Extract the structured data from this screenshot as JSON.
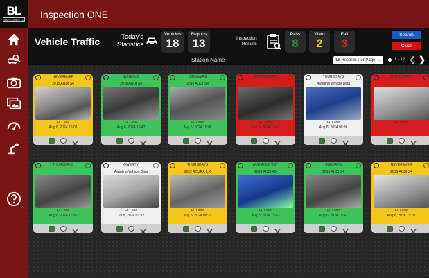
{
  "app": {
    "brand": "BL",
    "brand_sub": "BARCODE/ETC",
    "title": "Inspection ONE"
  },
  "sidebar": {
    "items": [
      {
        "icon": "home-icon"
      },
      {
        "icon": "search-car-icon"
      },
      {
        "icon": "camera-icon"
      },
      {
        "icon": "gallery-icon"
      },
      {
        "icon": "speedometer-icon"
      },
      {
        "icon": "robot-arm-icon"
      },
      {
        "icon": "help-icon"
      }
    ]
  },
  "stats": {
    "page_title": "Vehicle Traffic",
    "today_label_1": "Today's",
    "today_label_2": "Statistics",
    "vehicles_label": "Vehicles",
    "vehicles_value": "18",
    "reports_label": "Reports",
    "reports_value": "13",
    "inspection_label_1": "Inspection",
    "inspection_label_2": "Results",
    "pass_label": "Pass",
    "pass_value": "8",
    "warn_label": "Warn",
    "warn_value": "2",
    "fail_label": "Fail",
    "fail_value": "3",
    "search_label": "Search",
    "clear_label": "Clear",
    "colors": {
      "pass": "#3fc25a",
      "warn": "#f5c518",
      "fail": "#d61d1d"
    }
  },
  "subbar": {
    "station_column": "Station Name",
    "records_per_page": "18 Records Per Page",
    "range": "1 - 12"
  },
  "cards": [
    {
      "status": "yellow",
      "vin": "NEVEREVER",
      "model": "2015 AUDI S4",
      "lane": "FL Lane",
      "date": "Aug 6, 2024 15:08"
    },
    {
      "status": "green",
      "vin": "SUNDAYS",
      "model": "2016 AUDI S4",
      "lane": "FL Lane",
      "date": "Aug 6, 2024 15:42"
    },
    {
      "status": "green",
      "vin": "CINNAMAS",
      "model": "2016 AUDI S4",
      "lane": "FL Lane",
      "date": "Aug 6, 2024 15:06"
    },
    {
      "status": "red",
      "vin": "MUSTANGAS",
      "model": "",
      "lane": "FL Lane",
      "date": "Aug 6, 2024 15:41"
    },
    {
      "status": "white",
      "vin": "THURSDAYS",
      "model": "Awaiting Vehicle Data",
      "lane": "FL Lane",
      "date": "Aug 8, 2024 08:36"
    },
    {
      "status": "red",
      "vin": "SHOWCARAS",
      "model": "",
      "lane": "FL Lane",
      "date": ""
    },
    {
      "status": "green",
      "vin": "THURSDAYS",
      "model": "",
      "lane": "FL Lane",
      "date": "Aug 8, 2024 11:05"
    },
    {
      "status": "white",
      "vin": "QWERTY",
      "model": "Awaiting Vehicle Data",
      "lane": "FL Lane",
      "date": "Jul 8, 2024 01:32"
    },
    {
      "status": "yellow",
      "vin": "THURSDAYS",
      "model": "2022 ACURA ILX",
      "lane": "FL Lane",
      "date": "Aug 6, 2024 08:33"
    },
    {
      "status": "green",
      "vin": "AUDIAIRSTEST",
      "model": "2023 AUDI A3",
      "lane": "FL Lane",
      "date": "Aug 8, 2024 15:42"
    },
    {
      "status": "green",
      "vin": "SUNDAYS",
      "model": "2016 AUDI S4",
      "lane": "FL Lane",
      "date": "Aug 6, 2024 15:42"
    },
    {
      "status": "yellow",
      "vin": "NEVEREVER",
      "model": "2015 AUDI S4",
      "lane": "FL Lane",
      "date": "Aug 6, 2024 15:08"
    }
  ]
}
